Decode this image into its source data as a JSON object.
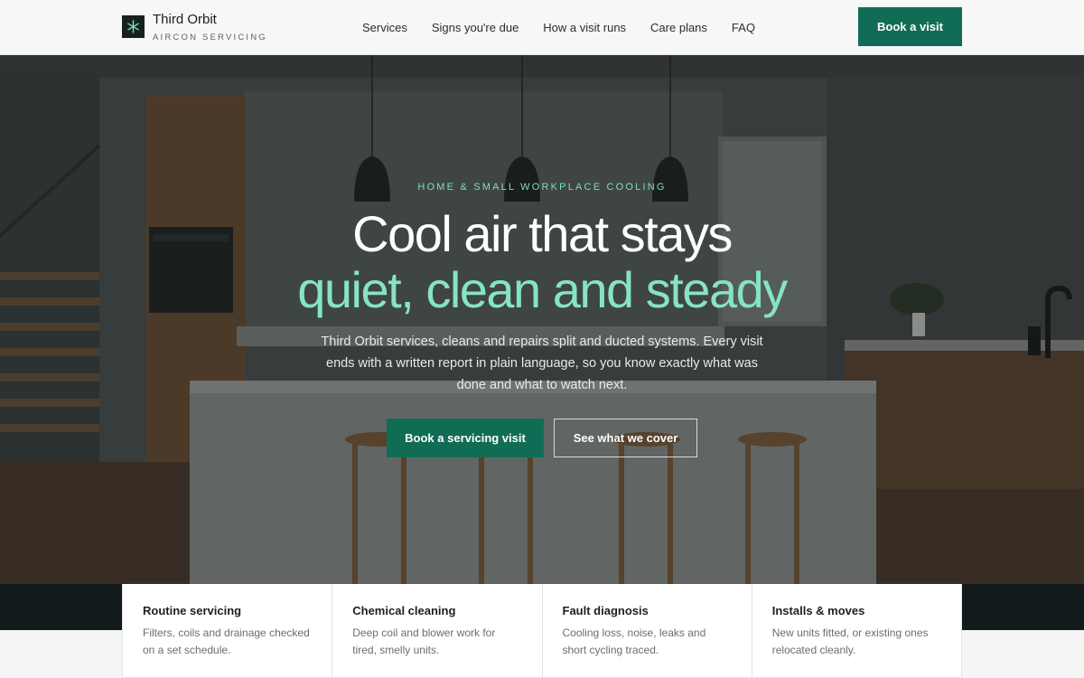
{
  "brand": {
    "name": "Third Orbit",
    "tagline": "AIRCON SERVICING",
    "logo_icon": "asterisk-icon"
  },
  "nav": {
    "items": [
      {
        "label": "Services"
      },
      {
        "label": "Signs you're due"
      },
      {
        "label": "How a visit runs"
      },
      {
        "label": "Care plans"
      },
      {
        "label": "FAQ"
      }
    ],
    "cta_label": "Book a visit"
  },
  "hero": {
    "eyebrow": "HOME & SMALL WORKPLACE COOLING",
    "headline_line1": "Cool air that stays",
    "headline_line2": "quiet, clean and steady",
    "lede": "Third Orbit services, cleans and repairs split and ducted systems. Every visit ends with a written report in plain language, so you know exactly what was done and what to watch next.",
    "primary_cta": "Book a servicing visit",
    "secondary_cta": "See what we cover"
  },
  "services": [
    {
      "title": "Routine servicing",
      "desc": "Filters, coils and drainage checked on a set schedule."
    },
    {
      "title": "Chemical cleaning",
      "desc": "Deep coil and blower work for tired, smelly units."
    },
    {
      "title": "Fault diagnosis",
      "desc": "Cooling loss, noise, leaks and short cycling traced."
    },
    {
      "title": "Installs & moves",
      "desc": "New units fitted, or existing ones relocated cleanly."
    }
  ],
  "colors": {
    "accent": "#116c55",
    "accent_light": "#86e3c5",
    "dark": "#121a1c"
  }
}
